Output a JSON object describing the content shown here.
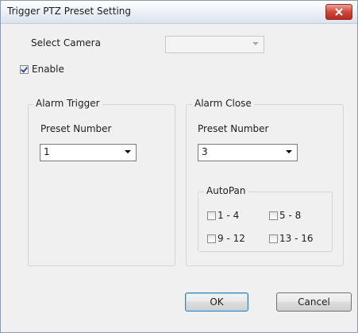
{
  "dialog": {
    "title": "Trigger PTZ Preset Setting"
  },
  "select_camera": {
    "label": "Select Camera",
    "value": ""
  },
  "enable": {
    "label": "Enable",
    "checked": true
  },
  "alarm_trigger": {
    "title": "Alarm Trigger",
    "preset_label": "Preset Number",
    "preset_value": "1"
  },
  "alarm_close": {
    "title": "Alarm Close",
    "preset_label": "Preset Number",
    "preset_value": "3",
    "autopan": {
      "title": "AutoPan",
      "options": [
        {
          "label": "1 - 4",
          "checked": false
        },
        {
          "label": "5 - 8",
          "checked": false
        },
        {
          "label": "9 - 12",
          "checked": false
        },
        {
          "label": "13 - 16",
          "checked": false
        }
      ]
    }
  },
  "buttons": {
    "ok": "OK",
    "cancel": "Cancel"
  },
  "colors": {
    "close_button": "#c9443a",
    "default_button_border": "#3c7fb1"
  },
  "icons": {
    "close": "close-icon",
    "dropdown": "chevron-down-icon",
    "check": "checkmark-icon"
  }
}
